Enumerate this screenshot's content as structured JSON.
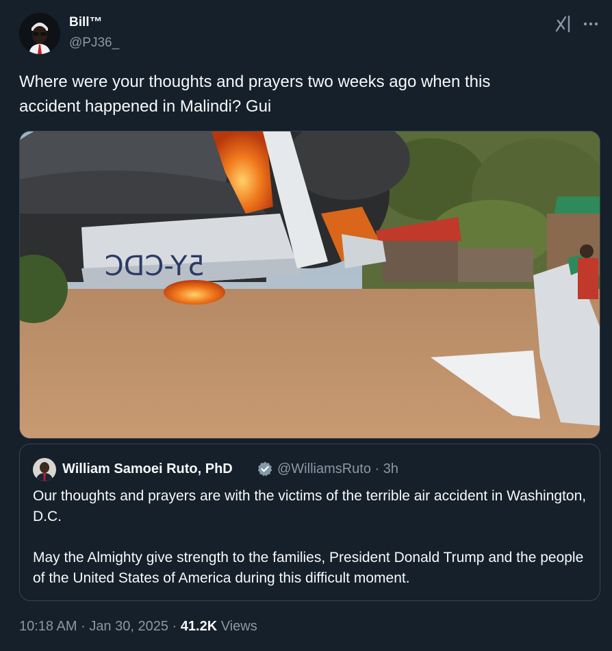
{
  "author": {
    "name": "Bill™",
    "handle": "@PJ36_"
  },
  "tweet": {
    "text_line1": "Where were your thoughts and prayers two weeks ago when this",
    "text_line2": "accident happened in Malindi? Gui"
  },
  "media": {
    "plane_registration": "5Y-CDC"
  },
  "quoted_tweet": {
    "name": "William Samoei Ruto, PhD",
    "handle": "@WilliamsRuto",
    "separator": "·",
    "time": "3h",
    "paragraph1": "Our thoughts and prayers are with the victims of the terrible air accident in Washington, D.C.",
    "paragraph2": "May the Almighty give strength to the families, President Donald Trump and the people of the United States of America during this difficult moment."
  },
  "meta": {
    "time": "10:18 AM",
    "separator": "·",
    "date": "Jan 30, 2025",
    "views_count": "41.2K",
    "views_label": "Views"
  },
  "icons": {
    "grok": "grok-icon",
    "more": "more-icon",
    "verified": "verified-badge-icon"
  },
  "colors": {
    "background": "#15202b",
    "text": "#f7f9f9",
    "secondary_text": "#8b98a5",
    "border": "#38444d",
    "verified_badge": "#829aab"
  }
}
